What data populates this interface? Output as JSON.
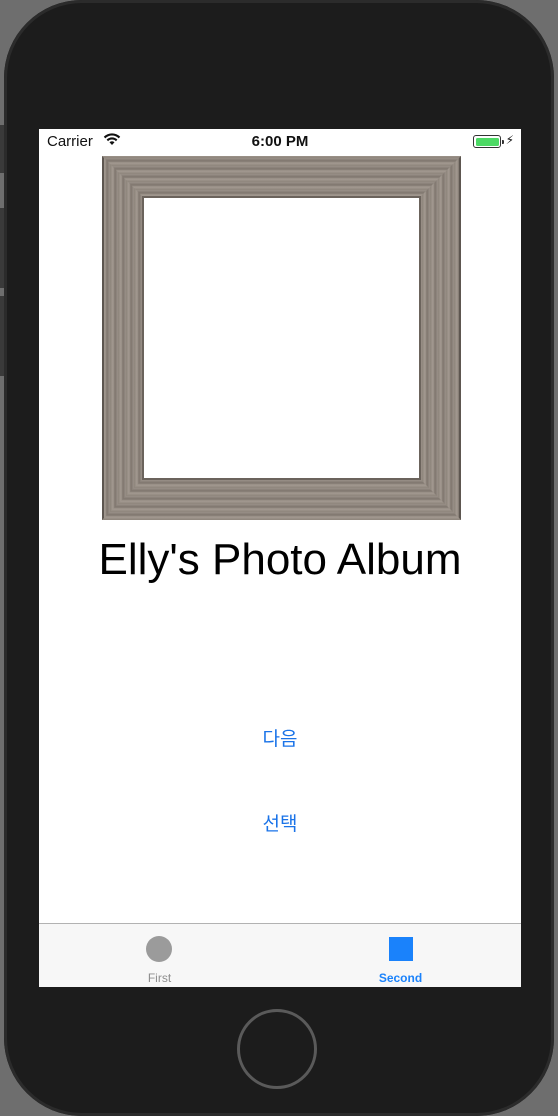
{
  "status_bar": {
    "carrier": "Carrier",
    "time": "6:00 PM"
  },
  "album": {
    "title": "Elly's Photo Album"
  },
  "buttons": {
    "next_label": "다음",
    "select_label": "선택"
  },
  "tab_bar": {
    "tabs": [
      {
        "label": "First",
        "icon": "circle-icon",
        "selected": false
      },
      {
        "label": "Second",
        "icon": "square-icon",
        "selected": true
      }
    ]
  },
  "colors": {
    "accent": "#1a82fb",
    "battery": "#4cd964",
    "device": "#1c1c1c"
  }
}
